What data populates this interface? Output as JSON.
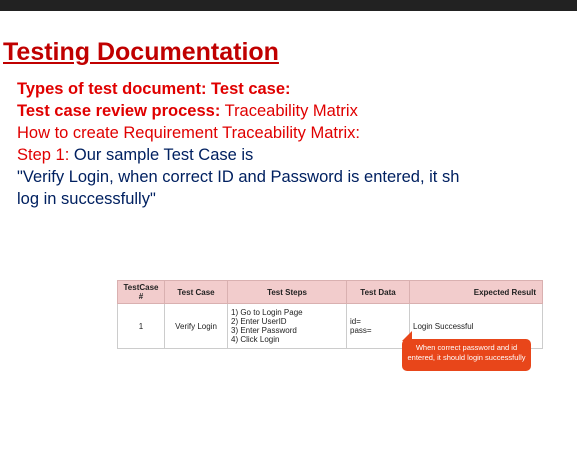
{
  "title": "Testing Documentation",
  "lines": {
    "l1_bold": "Types of test document: Test case:",
    "l2_bold": "Test case review process:",
    "l2_rest": " Traceability Matrix",
    "l3": "How to create Requirement Traceability Matrix:",
    "l4_red": "Step 1:",
    "l4_rest": " Our sample Test Case is",
    "l5": "\"Verify Login, when correct ID and Password is entered, it sh",
    "l6": "log in successfully\""
  },
  "table": {
    "headers": [
      "TestCase #",
      "Test Case",
      "Test Steps",
      "Test Data",
      "Expected Result"
    ],
    "row": {
      "id": "1",
      "test_case": "Verify Login",
      "steps": [
        "1) Go to Login Page",
        "2) Enter UserID",
        "3) Enter Password",
        "4) Click Login"
      ],
      "data": [
        "id=",
        "pass="
      ],
      "expected": "Login Successful"
    }
  },
  "callout": {
    "line1": "When correct password and id",
    "line2": "entered, it should login successfully"
  },
  "colors": {
    "heading_red": "#c00000",
    "text_red": "#e00000",
    "text_navy": "#002060",
    "header_fill": "#f2cccc",
    "callout_orange": "#e8461a"
  }
}
